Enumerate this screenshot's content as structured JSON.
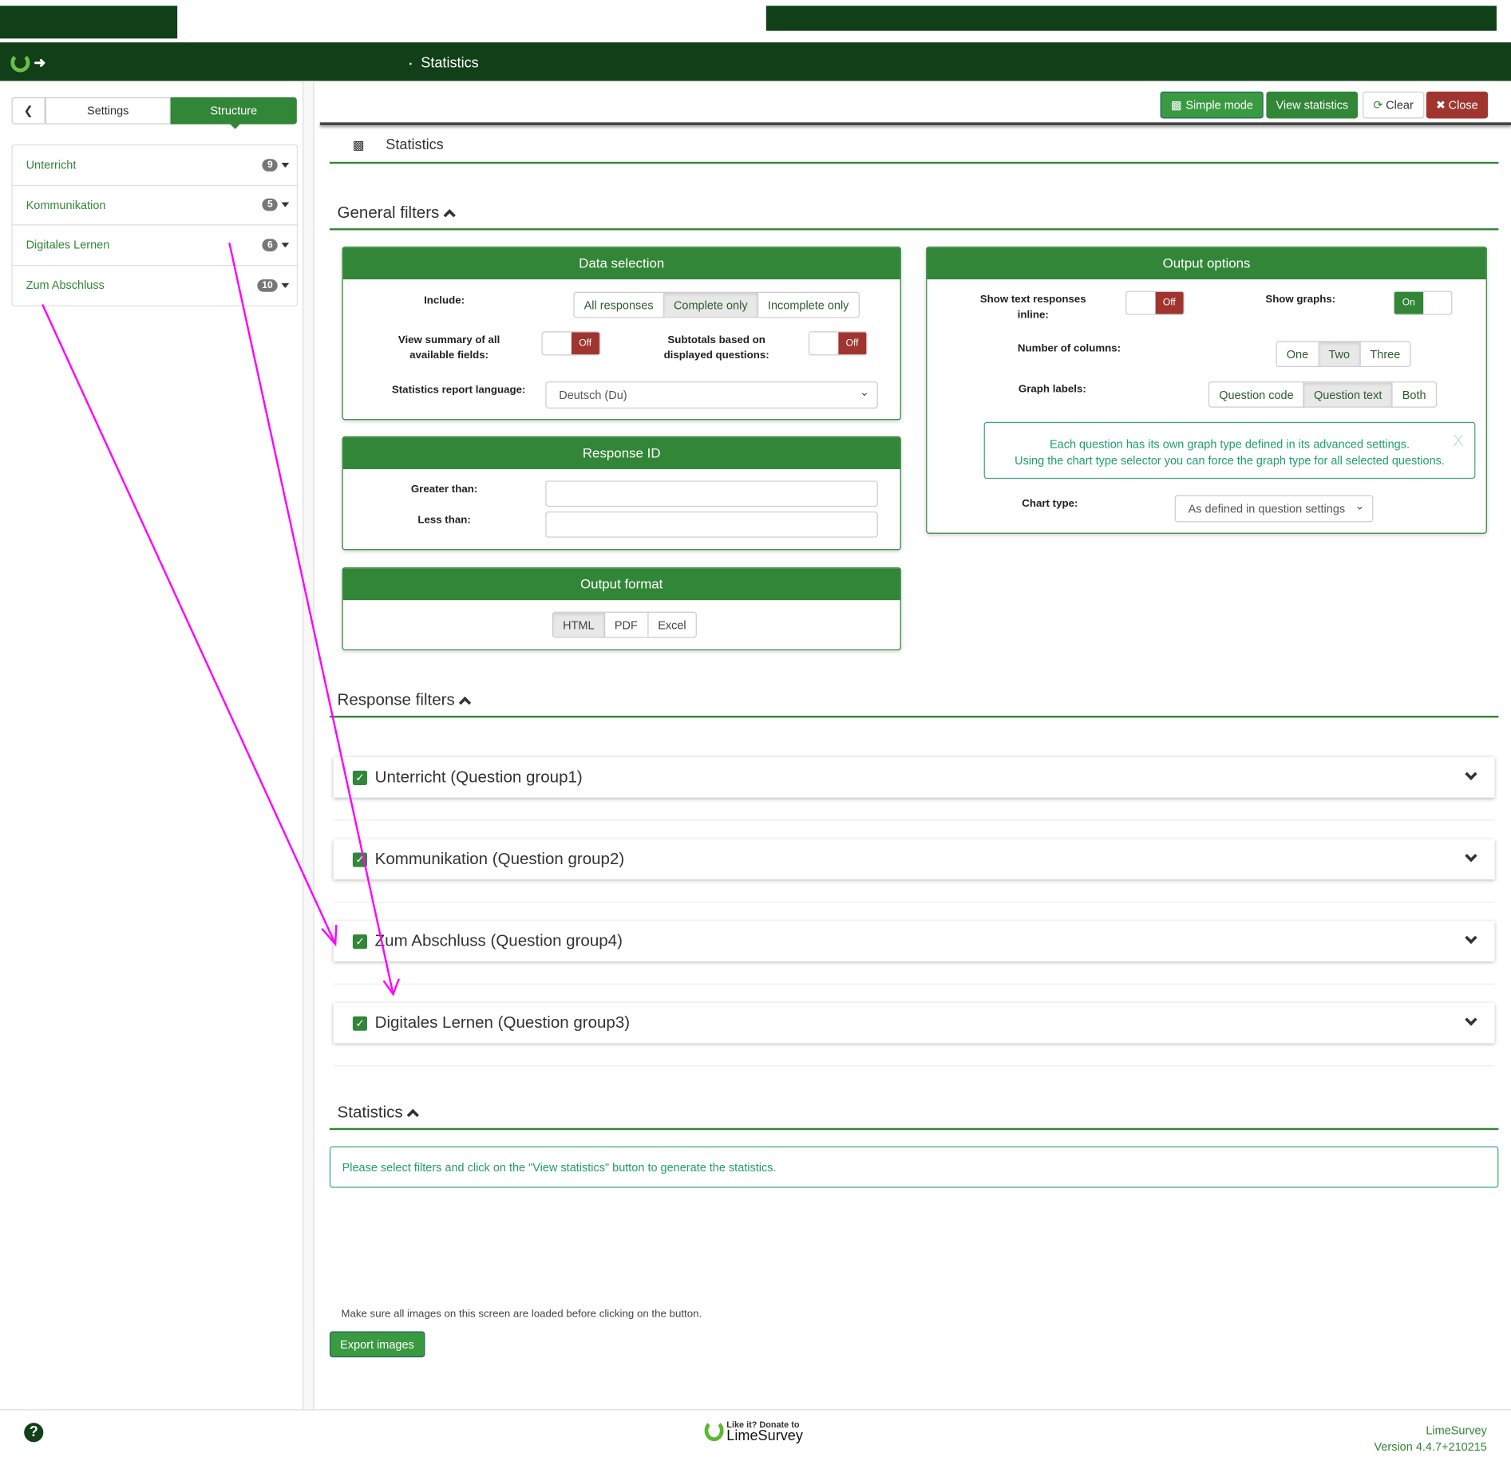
{
  "header": {
    "breadcrumb": "Statistics"
  },
  "sidebar": {
    "tabs": {
      "settings": "Settings",
      "structure": "Structure"
    },
    "items": [
      {
        "label": "Unterricht",
        "count": "9"
      },
      {
        "label": "Kommunikation",
        "count": "5"
      },
      {
        "label": "Digitales Lernen",
        "count": "6"
      },
      {
        "label": "Zum Abschluss",
        "count": "10"
      }
    ]
  },
  "toolbar": {
    "simple_mode": "Simple mode",
    "view_statistics": "View statistics",
    "clear": "Clear",
    "close": "Close"
  },
  "page_title": "Statistics",
  "general_filters": {
    "title": "General filters",
    "data_selection": {
      "title": "Data selection",
      "include_label": "Include:",
      "include_options": [
        "All responses",
        "Complete only",
        "Incomplete only"
      ],
      "include_selected": "Complete only",
      "summary_label": "View summary of all available fields:",
      "summary_value": "Off",
      "subtotals_label": "Subtotals based on displayed questions:",
      "subtotals_value": "Off",
      "language_label": "Statistics report language:",
      "language_value": "Deutsch (Du)"
    },
    "response_id": {
      "title": "Response ID",
      "greater_label": "Greater than:",
      "greater_value": "",
      "less_label": "Less than:",
      "less_value": ""
    },
    "output_format": {
      "title": "Output format",
      "options": [
        "HTML",
        "PDF",
        "Excel"
      ],
      "selected": "HTML"
    },
    "output_options": {
      "title": "Output options",
      "text_inline_label": "Show text responses inline:",
      "text_inline_value": "Off",
      "graphs_label": "Show graphs:",
      "graphs_value": "On",
      "columns_label": "Number of columns:",
      "columns_options": [
        "One",
        "Two",
        "Three"
      ],
      "columns_selected": "Two",
      "graph_labels_label": "Graph labels:",
      "graph_labels_options": [
        "Question code",
        "Question text",
        "Both"
      ],
      "graph_labels_selected": "Question text",
      "info_line1": "Each question has its own graph type defined in its advanced settings.",
      "info_line2": "Using the chart type selector you can force the graph type for all selected questions.",
      "info_close": "X",
      "chart_type_label": "Chart type:",
      "chart_type_value": "As defined in question settings"
    }
  },
  "response_filters": {
    "title": "Response filters",
    "groups": [
      "Unterricht (Question group1)",
      "Kommunikation (Question group2)",
      "Zum Abschluss (Question group4)",
      "Digitales Lernen (Question group3)"
    ]
  },
  "statistics": {
    "title": "Statistics",
    "message": "Please select filters and click on the \"View statistics\" button to generate the statistics."
  },
  "export": {
    "note": "Make sure all images on this screen are loaded before clicking on the button.",
    "button": "Export images"
  },
  "footer": {
    "donate_small": "Like it? Donate to",
    "donate_big": "LimeSurvey",
    "brand": "LimeSurvey",
    "version": "Version 4.4.7+210215"
  },
  "colors": {
    "primary": "#328637",
    "dark": "#113f17",
    "danger": "#a03530",
    "annotation": "#ff00ff"
  }
}
